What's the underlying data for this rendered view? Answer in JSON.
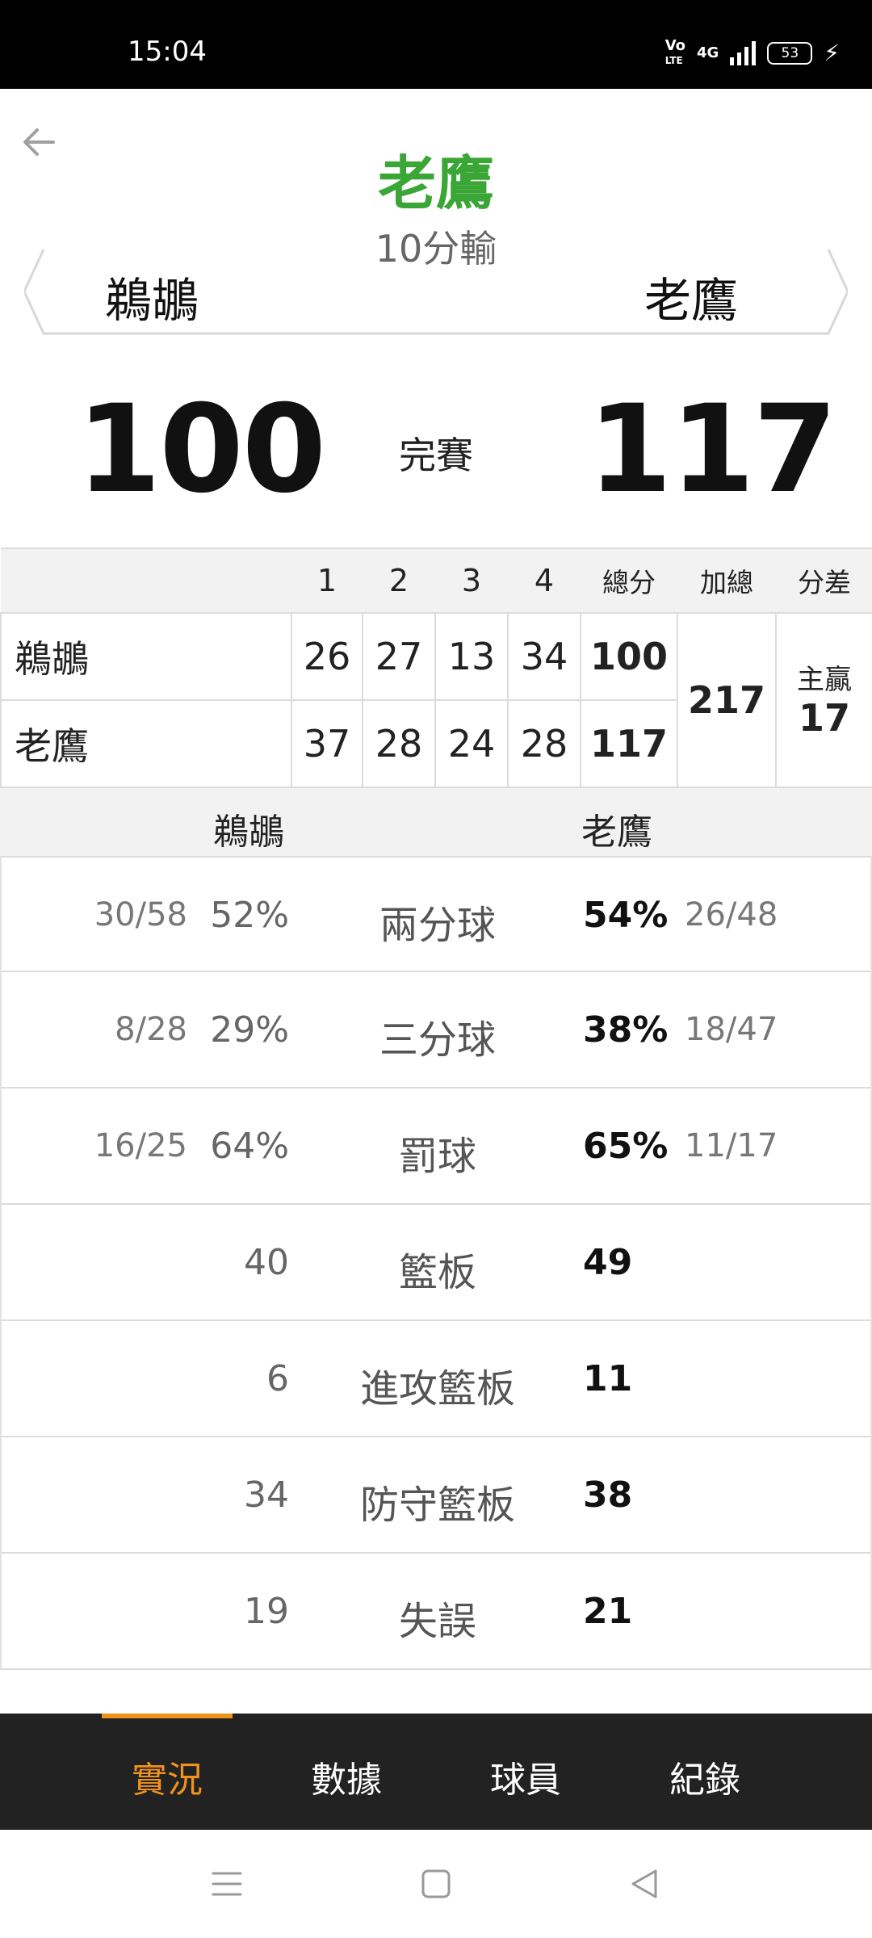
{
  "status_bar": {
    "time": "15:04",
    "volte_top": "Vo",
    "volte_bottom": "LTE",
    "network": "4G",
    "battery": "53"
  },
  "header": {
    "winner": "老鷹",
    "result": "10分輸",
    "home_team": "鵜鶘",
    "away_team": "老鷹"
  },
  "score": {
    "left": "100",
    "right": "117",
    "state": "完賽"
  },
  "quarter_table": {
    "headers": [
      "1",
      "2",
      "3",
      "4",
      "總分",
      "加總",
      "分差"
    ],
    "rows": [
      {
        "team": "鵜鶘",
        "q": [
          "26",
          "27",
          "13",
          "34"
        ],
        "total": "100"
      },
      {
        "team": "老鷹",
        "q": [
          "37",
          "28",
          "24",
          "28"
        ],
        "total": "117"
      }
    ],
    "sum": "217",
    "diff_label": "主贏",
    "diff_value": "17"
  },
  "compare": {
    "left_team": "鵜鶘",
    "right_team": "老鷹",
    "rows": [
      {
        "label": "兩分球",
        "left_frac": "30/58",
        "left": "52%",
        "right": "54%",
        "right_frac": "26/48"
      },
      {
        "label": "三分球",
        "left_frac": "8/28",
        "left": "29%",
        "right": "38%",
        "right_frac": "18/47"
      },
      {
        "label": "罰球",
        "left_frac": "16/25",
        "left": "64%",
        "right": "65%",
        "right_frac": "11/17"
      },
      {
        "label": "籃板",
        "left_frac": "",
        "left": "40",
        "right": "49",
        "right_frac": ""
      },
      {
        "label": "進攻籃板",
        "left_frac": "",
        "left": "6",
        "right": "11",
        "right_frac": ""
      },
      {
        "label": "防守籃板",
        "left_frac": "",
        "left": "34",
        "right": "38",
        "right_frac": ""
      },
      {
        "label": "失誤",
        "left_frac": "",
        "left": "19",
        "right": "21",
        "right_frac": ""
      }
    ]
  },
  "bottom_nav": {
    "items": [
      "實況",
      "數據",
      "球員",
      "紀錄"
    ],
    "active_color": "#f0921e"
  },
  "colors": {
    "winner": "#3aa635",
    "nav_bg": "#222222"
  }
}
